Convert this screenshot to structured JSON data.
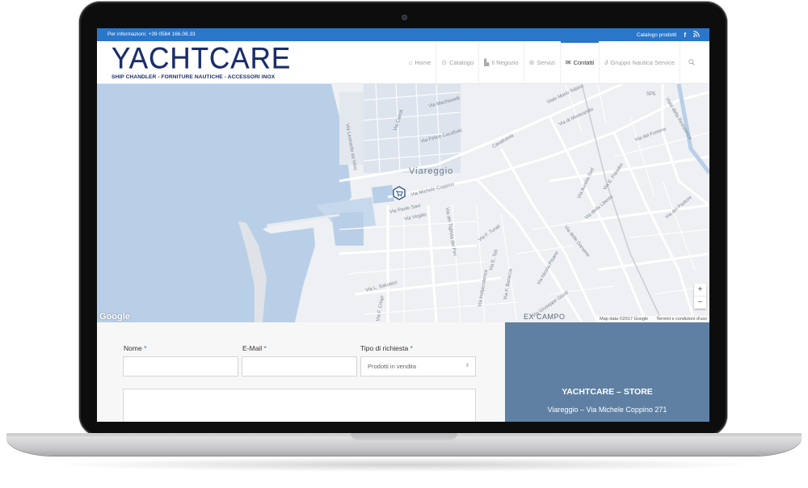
{
  "topbar": {
    "info": "Per informazioni: +39 0584 166.08.33",
    "catalog": "Catalogo prodotti",
    "social": [
      "facebook-icon",
      "rss-icon"
    ]
  },
  "logo": {
    "word": "YACHTCARE",
    "tagline": "SHIP CHANDLER - FORNITURE NAUTICHE - ACCESSORI INOX"
  },
  "nav": {
    "items": [
      {
        "label": "Home",
        "icon": "home-icon"
      },
      {
        "label": "Catalogo",
        "icon": "catalog-icon"
      },
      {
        "label": "Il Negozio",
        "icon": "building-icon"
      },
      {
        "label": "Servizi",
        "icon": "services-icon"
      },
      {
        "label": "Contatti",
        "icon": "envelope-icon",
        "active": true
      },
      {
        "label": "Gruppo Nautica Service",
        "icon": "link-icon"
      }
    ],
    "search_icon": "search-icon"
  },
  "map": {
    "city": "Viareggio",
    "district": "EX CAMPO",
    "streets": [
      "Via Michele Coppino",
      "Via Paolo Savi",
      "Via Virgilio",
      "Via Leonardo da Vinci",
      "Via Machiavelli",
      "Via Cairoli",
      "Via Felice Cavallotti",
      "Viale Mario Tobino",
      "Via di Montramito",
      "Cavalcavia",
      "Via del Fortone",
      "Via Aurelia Sud",
      "Via della Liberta",
      "Via delle Darsene",
      "Via F. Turati",
      "Via Nicola Pisano",
      "Via L. Salvatori",
      "Via Giuseppe Giusti",
      "Via E. Toti",
      "Via dei Pini",
      "Viale della Resistenza",
      "SP5",
      "Via del Pastore",
      "Via E. Paladini",
      "Via dei Tigli",
      "Via F. Baracca",
      "Via F. Crispi",
      "Via Indipendenza"
    ],
    "google": "Google",
    "attribution": "Map data ©2017 Google",
    "terms": "Termini e condizioni d'uso",
    "zoom_in": "+",
    "zoom_out": "−"
  },
  "form": {
    "name_label": "Nome",
    "email_label": "E-Mail",
    "type_label": "Tipo di richiesta",
    "required_mark": "*",
    "type_value": "Prodotti in vendita"
  },
  "store": {
    "title": "YACHTCARE – STORE",
    "address": "Viareggio – Via Michele Coppino 271"
  },
  "colors": {
    "primary": "#2a76c9",
    "store_panel": "#5f80a3",
    "logo": "#1a2d6a",
    "sea": "#b9cfe8",
    "land": "#eef0f3"
  }
}
